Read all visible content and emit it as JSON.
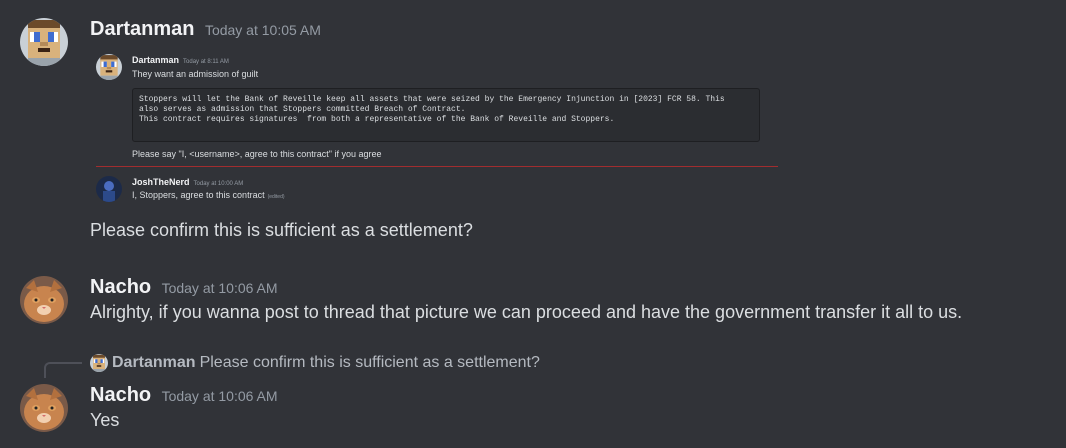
{
  "messages": [
    {
      "author": "Dartanman",
      "timestamp": "Today at 10:05 AM",
      "embedded_screenshot": {
        "quoted_message": {
          "author": "Dartanman",
          "timestamp": "Today at 8:11 AM",
          "text": "They want an admission of guilt",
          "code_lines": [
            "Stoppers will let the Bank of Reveille keep all assets that were seized by the Emergency Injunction in [2023] FCR 58. This",
            "also serves as admission that Stoppers committed Breach of Contract.",
            "",
            "This contract requires signatures  from both a representative of the Bank of Reveille and Stoppers."
          ],
          "footer": "Please say \"I, <username>, agree to this contract\" if you agree"
        },
        "reply_message": {
          "author": "JoshTheNerd",
          "timestamp": "Today at 10:00 AM",
          "text": "I, Stoppers, agree to this contract",
          "edited": "(edited)"
        }
      },
      "text": "Please confirm this is sufficient as a settlement?"
    },
    {
      "author": "Nacho",
      "timestamp": "Today at 10:06 AM",
      "text": "Alrighty, if you wanna post to thread that picture we can proceed and have the government transfer it all to us."
    },
    {
      "reply_to": {
        "author": "Dartanman",
        "text": "Please confirm this is sufficient as a settlement?"
      },
      "author": "Nacho",
      "timestamp": "Today at 10:06 AM",
      "text": "Yes"
    }
  ],
  "colors": {
    "background": "#313338",
    "text": "#dbdee1",
    "author": "#f2f3f5",
    "timestamp": "#949ba4",
    "divider": "#a12d2f"
  },
  "icons": [
    "pixel-avatar-icon",
    "cat-avatar-icon",
    "nerd-avatar-icon"
  ]
}
